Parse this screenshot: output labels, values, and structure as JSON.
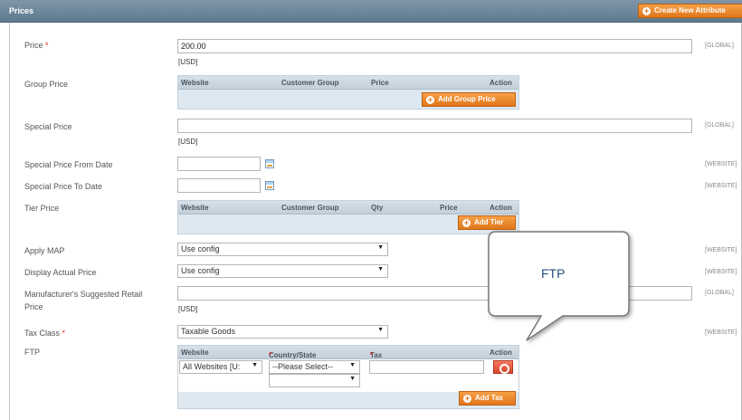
{
  "header": {
    "title": "Prices",
    "create_attr_button": "Create New Attribute"
  },
  "price": {
    "label": "Price",
    "required": "*",
    "value": "200.00",
    "currency": "[USD]",
    "scope": "[GLOBAL]"
  },
  "group_price": {
    "label": "Group Price",
    "columns": [
      "Website",
      "Customer Group",
      "Price",
      "Action"
    ],
    "add_button": "Add Group Price"
  },
  "special_price": {
    "label": "Special Price",
    "value": "",
    "currency": "[USD]",
    "scope": "[GLOBAL]"
  },
  "special_from": {
    "label": "Special Price From Date",
    "value": "",
    "scope": "[WEBSITE]"
  },
  "special_to": {
    "label": "Special Price To Date",
    "value": "",
    "scope": "[WEBSITE]"
  },
  "tier_price": {
    "label": "Tier Price",
    "columns": [
      "Website",
      "Customer Group",
      "Qty",
      "Price",
      "Action"
    ],
    "add_button": "Add Tier"
  },
  "apply_map": {
    "label": "Apply MAP",
    "value": "Use config",
    "scope": "[WEBSITE]"
  },
  "display_actual": {
    "label": "Display Actual Price",
    "value": "Use config",
    "scope": "[WEBSITE]"
  },
  "msrp": {
    "label_line1": "Manufacturer's Suggested Retail",
    "label_line2": "Price",
    "value": "",
    "currency": "[USD]",
    "scope": "[GLOBAL]"
  },
  "tax_class": {
    "label": "Tax Class",
    "required": "*",
    "value": "Taxable Goods",
    "scope": "[WEBSITE]"
  },
  "ftp": {
    "label": "FTP",
    "columns": [
      "Website",
      "Country/State",
      "Tax",
      "Action"
    ],
    "required": "*",
    "website_value": "All Websites [U:",
    "country_value": "--Please Select--",
    "state_value": "",
    "tax_value": "",
    "add_button": "Add Tax"
  },
  "callout": {
    "text": "FTP"
  },
  "colors": {
    "header": "#6f889b",
    "accent": "#e8831f",
    "danger": "#d9452b",
    "callout_text": "#2a4e7c"
  }
}
